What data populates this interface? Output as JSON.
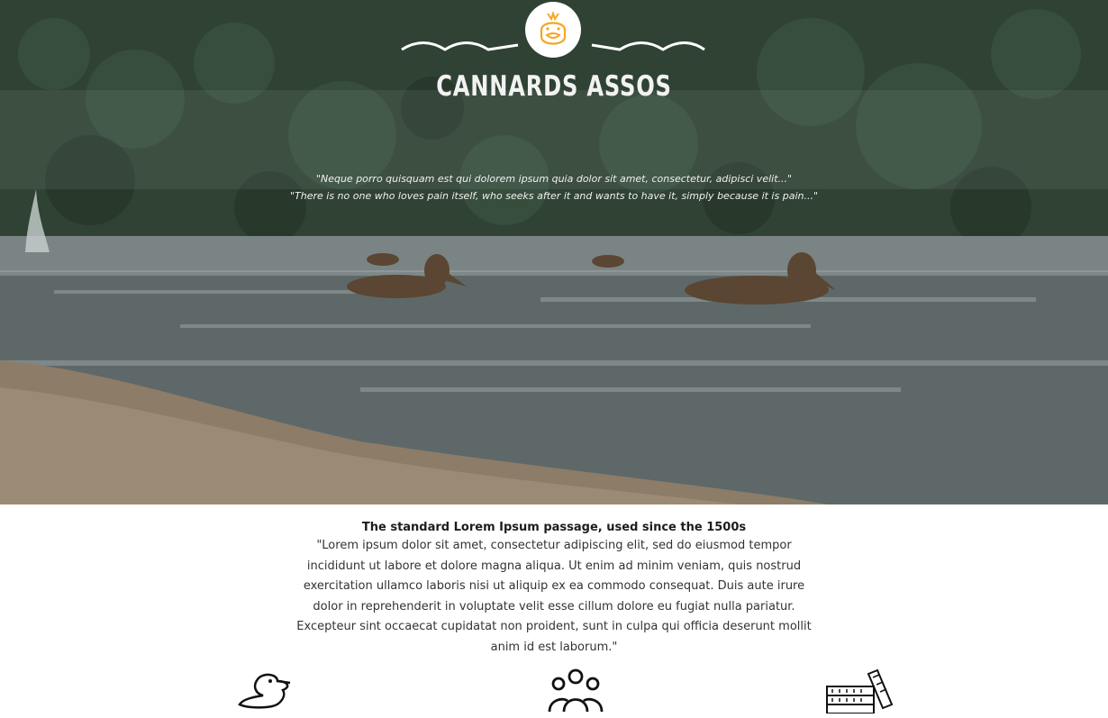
{
  "header": {
    "title": "CANNARDS ASSOS",
    "logo_icon": "duck-face-icon",
    "quote_line_1": "\"Neque porro quisquam est qui dolorem ipsum quia dolor sit amet, consectetur, adipisci velit...\"",
    "quote_line_2": "\"There is no one who loves pain itself, who seeks after it and wants to have it, simply because it is pain...\""
  },
  "intro": {
    "heading": "The standard Lorem Ipsum passage, used since the 1500s",
    "body": "\"Lorem ipsum dolor sit amet, consectetur adipiscing elit, sed do eiusmod tempor incididunt ut labore et dolore magna aliqua. Ut enim ad minim veniam, quis nostrud exercitation ullamco laboris nisi ut aliquip ex ea commodo consequat. Duis aute irure dolor in reprehenderit in voluptate velit esse cillum dolore eu fugiat nulla pariatur. Excepteur sint occaecat cupidatat non proident, sunt in culpa qui officia deserunt mollit anim id est laborum.\""
  },
  "features": [
    {
      "icon": "duck-icon"
    },
    {
      "icon": "group-icon"
    },
    {
      "icon": "money-stack-icon"
    }
  ],
  "colors": {
    "logo_accent": "#f5a623",
    "title_text": "#f2f2f2",
    "body_text": "#333333"
  }
}
